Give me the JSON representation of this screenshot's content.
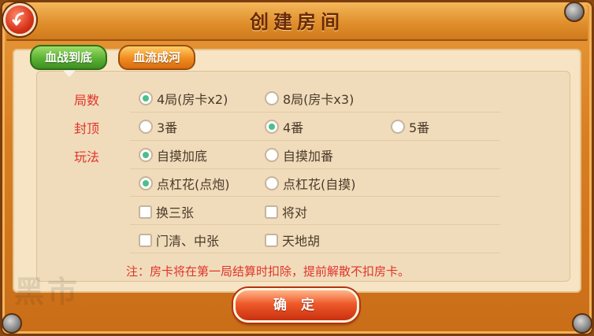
{
  "dialog": {
    "title": "创建房间",
    "confirm_label": "确 定",
    "note": "注：房卡将在第一局结算时扣除，提前解散不扣房卡。"
  },
  "tabs": [
    {
      "label": "血战到底",
      "active": true
    },
    {
      "label": "血流成河",
      "active": false
    }
  ],
  "rows": {
    "rounds": {
      "label": "局数",
      "options": [
        {
          "label": "4局(房卡x2)",
          "selected": true
        },
        {
          "label": "8局(房卡x3)",
          "selected": false
        }
      ]
    },
    "cap": {
      "label": "封顶",
      "options": [
        {
          "label": "3番",
          "selected": false
        },
        {
          "label": "4番",
          "selected": true
        },
        {
          "label": "5番",
          "selected": false
        }
      ]
    },
    "rules": {
      "label": "玩法",
      "radio_group_1": [
        {
          "label": "自摸加底",
          "selected": true
        },
        {
          "label": "自摸加番",
          "selected": false
        }
      ],
      "radio_group_2": [
        {
          "label": "点杠花(点炮)",
          "selected": true
        },
        {
          "label": "点杠花(自摸)",
          "selected": false
        }
      ],
      "checkboxes": [
        {
          "label": "换三张",
          "checked": false
        },
        {
          "label": "将对",
          "checked": false
        },
        {
          "label": "门清、中张",
          "checked": false
        },
        {
          "label": "天地胡",
          "checked": false
        }
      ]
    }
  },
  "watermark": "黑市",
  "colors": {
    "accent_red": "#e0342a",
    "radio_selected": "#4cbf8a",
    "tab_active": "#5ab233",
    "tab_inactive": "#f08b1f"
  }
}
